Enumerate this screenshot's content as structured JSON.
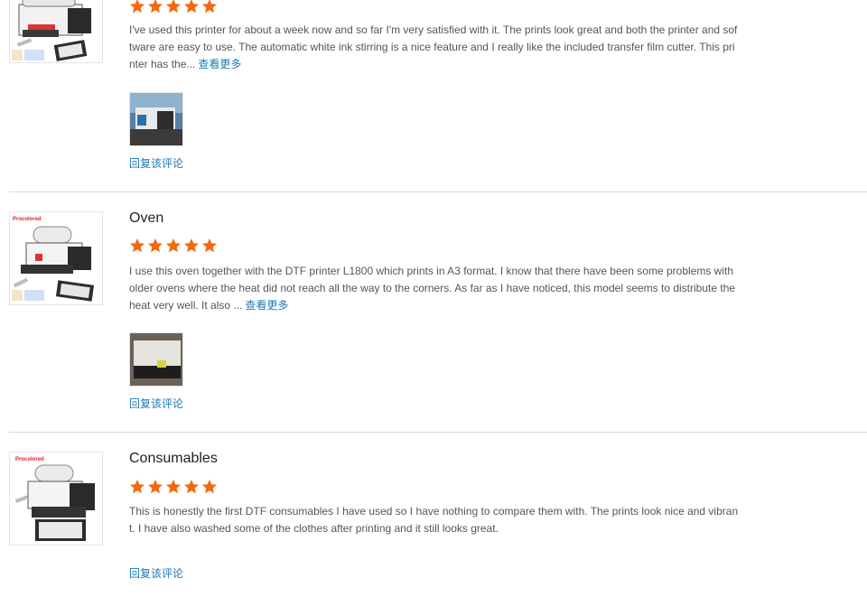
{
  "reviews": [
    {
      "title": "",
      "rating": 5,
      "body": "I've used this printer for about a week now and so far I'm very satisfied with it. The prints look great and both the printer and software are easy to use. The automatic white ink stirring is a nice feature and I really like the included transfer film cutter. This printer has the...",
      "more_label": "查看更多",
      "reply_label": "回复该评论",
      "has_photo": true
    },
    {
      "title": "Oven",
      "rating": 5,
      "body": "I use this oven together with the DTF printer L1800 which prints in A3 format. I know that there have been some problems with older ovens where the heat did not reach all the way to the corners. As far as I have noticed, this model seems to distribute the heat very well. It also ...",
      "more_label": "查看更多",
      "reply_label": "回复该评论",
      "has_photo": true
    },
    {
      "title": "Consumables",
      "rating": 5,
      "body": "This is honestly the first DTF consumables I have used so I have nothing to compare them with. The prints look nice and vibrant. I have also washed some of the clothes after printing and it still looks great.",
      "more_label": "",
      "reply_label": "回复该评论",
      "has_photo": false
    }
  ],
  "brand_mark": "Procolored",
  "colors": {
    "star": "#f26a10",
    "link": "#1a7ab9",
    "divider": "#d9d9d9"
  }
}
